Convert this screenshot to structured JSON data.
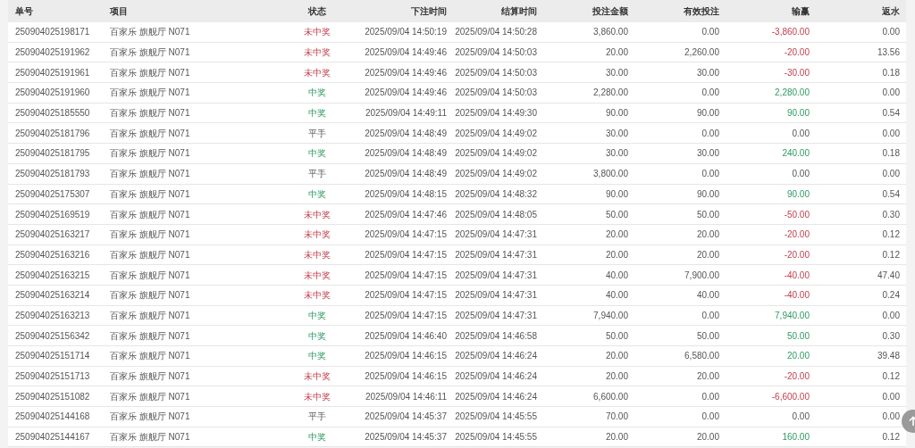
{
  "table": {
    "columns": [
      "单号",
      "项目",
      "状态",
      "下注时间",
      "结算时间",
      "投注金额",
      "有效投注",
      "输赢",
      "返水"
    ],
    "rows": [
      {
        "kind": "loss",
        "cells": [
          "250904025198171",
          "百家乐 旗舰厅 N071",
          "未中奖",
          "2025/09/04 14:50:19",
          "2025/09/04 14:50:28",
          "3,860.00",
          "0.00",
          "-3,860.00",
          "0.00"
        ]
      },
      {
        "kind": "loss",
        "cells": [
          "250904025191962",
          "百家乐 旗舰厅 N071",
          "未中奖",
          "2025/09/04 14:49:46",
          "2025/09/04 14:50:03",
          "20.00",
          "2,260.00",
          "-20.00",
          "13.56"
        ]
      },
      {
        "kind": "loss",
        "cells": [
          "250904025191961",
          "百家乐 旗舰厅 N071",
          "未中奖",
          "2025/09/04 14:49:46",
          "2025/09/04 14:50:03",
          "30.00",
          "30.00",
          "-30.00",
          "0.18"
        ]
      },
      {
        "kind": "win",
        "cells": [
          "250904025191960",
          "百家乐 旗舰厅 N071",
          "中奖",
          "2025/09/04 14:49:46",
          "2025/09/04 14:50:03",
          "2,280.00",
          "0.00",
          "2,280.00",
          "0.00"
        ]
      },
      {
        "kind": "win",
        "cells": [
          "250904025185550",
          "百家乐 旗舰厅 N071",
          "中奖",
          "2025/09/04 14:49:11",
          "2025/09/04 14:49:30",
          "90.00",
          "90.00",
          "90.00",
          "0.54"
        ]
      },
      {
        "kind": "push",
        "cells": [
          "250904025181796",
          "百家乐 旗舰厅 N071",
          "平手",
          "2025/09/04 14:48:49",
          "2025/09/04 14:49:02",
          "30.00",
          "0.00",
          "0.00",
          "0.00"
        ]
      },
      {
        "kind": "win",
        "cells": [
          "250904025181795",
          "百家乐 旗舰厅 N071",
          "中奖",
          "2025/09/04 14:48:49",
          "2025/09/04 14:49:02",
          "30.00",
          "30.00",
          "240.00",
          "0.18"
        ]
      },
      {
        "kind": "push",
        "cells": [
          "250904025181793",
          "百家乐 旗舰厅 N071",
          "平手",
          "2025/09/04 14:48:49",
          "2025/09/04 14:49:02",
          "3,800.00",
          "0.00",
          "0.00",
          "0.00"
        ]
      },
      {
        "kind": "win",
        "cells": [
          "250904025175307",
          "百家乐 旗舰厅 N071",
          "中奖",
          "2025/09/04 14:48:15",
          "2025/09/04 14:48:32",
          "90.00",
          "90.00",
          "90.00",
          "0.54"
        ]
      },
      {
        "kind": "loss",
        "cells": [
          "250904025169519",
          "百家乐 旗舰厅 N071",
          "未中奖",
          "2025/09/04 14:47:46",
          "2025/09/04 14:48:05",
          "50.00",
          "50.00",
          "-50.00",
          "0.30"
        ]
      },
      {
        "kind": "loss",
        "cells": [
          "250904025163217",
          "百家乐 旗舰厅 N071",
          "未中奖",
          "2025/09/04 14:47:15",
          "2025/09/04 14:47:31",
          "20.00",
          "20.00",
          "-20.00",
          "0.12"
        ]
      },
      {
        "kind": "loss",
        "cells": [
          "250904025163216",
          "百家乐 旗舰厅 N071",
          "未中奖",
          "2025/09/04 14:47:15",
          "2025/09/04 14:47:31",
          "20.00",
          "20.00",
          "-20.00",
          "0.12"
        ]
      },
      {
        "kind": "loss",
        "cells": [
          "250904025163215",
          "百家乐 旗舰厅 N071",
          "未中奖",
          "2025/09/04 14:47:15",
          "2025/09/04 14:47:31",
          "40.00",
          "7,900.00",
          "-40.00",
          "47.40"
        ]
      },
      {
        "kind": "loss",
        "cells": [
          "250904025163214",
          "百家乐 旗舰厅 N071",
          "未中奖",
          "2025/09/04 14:47:15",
          "2025/09/04 14:47:31",
          "40.00",
          "40.00",
          "-40.00",
          "0.24"
        ]
      },
      {
        "kind": "win",
        "cells": [
          "250904025163213",
          "百家乐 旗舰厅 N071",
          "中奖",
          "2025/09/04 14:47:15",
          "2025/09/04 14:47:31",
          "7,940.00",
          "0.00",
          "7,940.00",
          "0.00"
        ]
      },
      {
        "kind": "win",
        "cells": [
          "250904025156342",
          "百家乐 旗舰厅 N071",
          "中奖",
          "2025/09/04 14:46:40",
          "2025/09/04 14:46:58",
          "50.00",
          "50.00",
          "50.00",
          "0.30"
        ]
      },
      {
        "kind": "win",
        "cells": [
          "250904025151714",
          "百家乐 旗舰厅 N071",
          "中奖",
          "2025/09/04 14:46:15",
          "2025/09/04 14:46:24",
          "20.00",
          "6,580.00",
          "20.00",
          "39.48"
        ]
      },
      {
        "kind": "loss",
        "cells": [
          "250904025151713",
          "百家乐 旗舰厅 N071",
          "未中奖",
          "2025/09/04 14:46:15",
          "2025/09/04 14:46:24",
          "20.00",
          "20.00",
          "-20.00",
          "0.12"
        ]
      },
      {
        "kind": "loss",
        "cells": [
          "250904025151082",
          "百家乐 旗舰厅 N071",
          "未中奖",
          "2025/09/04 14:46:11",
          "2025/09/04 14:46:24",
          "6,600.00",
          "0.00",
          "-6,600.00",
          "0.00"
        ]
      },
      {
        "kind": "push",
        "cells": [
          "250904025144168",
          "百家乐 旗舰厅 N071",
          "平手",
          "2025/09/04 14:45:37",
          "2025/09/04 14:45:55",
          "70.00",
          "0.00",
          "0.00",
          "0.00"
        ]
      },
      {
        "kind": "win",
        "cells": [
          "250904025144167",
          "百家乐 旗舰厅 N071",
          "中奖",
          "2025/09/04 14:45:37",
          "2025/09/04 14:45:55",
          "20.00",
          "20.00",
          "160.00",
          "0.12"
        ]
      }
    ]
  }
}
